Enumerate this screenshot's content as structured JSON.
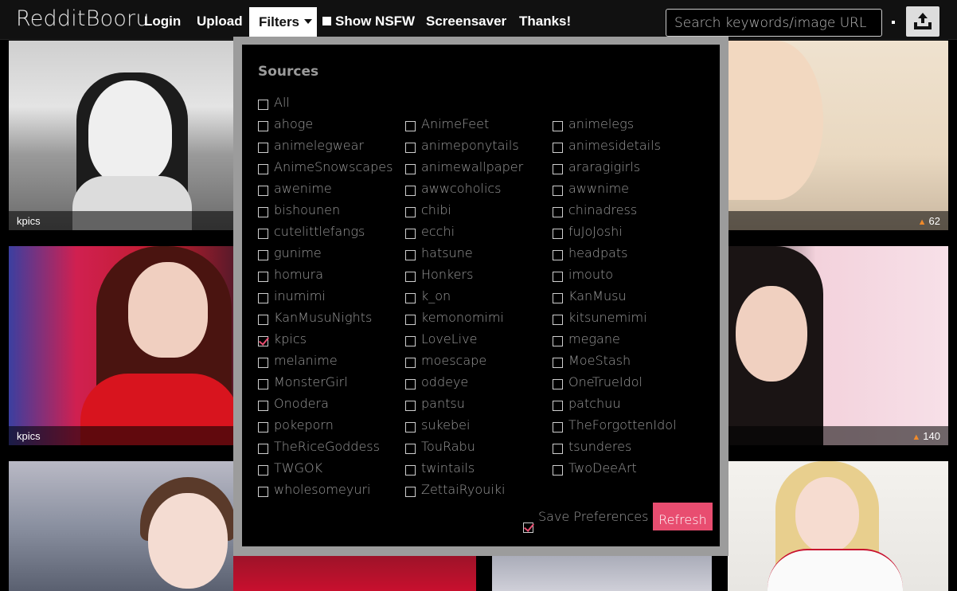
{
  "brand": "RedditBooru",
  "nav": {
    "login": "Login",
    "upload": "Upload",
    "filters": "Filters",
    "nsfw": "Show NSFW",
    "screensaver": "Screensaver",
    "thanks": "Thanks!"
  },
  "search": {
    "placeholder": "Search keywords/image URL",
    "value": ""
  },
  "upload_icon": "upload-tray-icon",
  "tiles": [
    {
      "caption": "kpics",
      "score": ""
    },
    {
      "caption": "kpics",
      "score": ""
    },
    {
      "caption": "",
      "score": "62"
    },
    {
      "caption": "",
      "score": "140"
    }
  ],
  "filters": {
    "title": "Sources",
    "all_label": "All",
    "sources": [
      {
        "label": "ahoge",
        "checked": false
      },
      {
        "label": "AnimeFeet",
        "checked": false
      },
      {
        "label": "animelegs",
        "checked": false
      },
      {
        "label": "animelegwear",
        "checked": false
      },
      {
        "label": "animeponytails",
        "checked": false
      },
      {
        "label": "animesidetails",
        "checked": false
      },
      {
        "label": "AnimeSnowscapes",
        "checked": false
      },
      {
        "label": "animewallpaper",
        "checked": false
      },
      {
        "label": "araragigirls",
        "checked": false
      },
      {
        "label": "awenime",
        "checked": false
      },
      {
        "label": "awwcoholics",
        "checked": false
      },
      {
        "label": "awwnime",
        "checked": false
      },
      {
        "label": "bishounen",
        "checked": false
      },
      {
        "label": "chibi",
        "checked": false
      },
      {
        "label": "chinadress",
        "checked": false
      },
      {
        "label": "cutelittlefangs",
        "checked": false
      },
      {
        "label": "ecchi",
        "checked": false
      },
      {
        "label": "fuJoJoshi",
        "checked": false
      },
      {
        "label": "gunime",
        "checked": false
      },
      {
        "label": "hatsune",
        "checked": false
      },
      {
        "label": "headpats",
        "checked": false
      },
      {
        "label": "homura",
        "checked": false
      },
      {
        "label": "Honkers",
        "checked": false
      },
      {
        "label": "imouto",
        "checked": false
      },
      {
        "label": "inumimi",
        "checked": false
      },
      {
        "label": "k_on",
        "checked": false
      },
      {
        "label": "KanMusu",
        "checked": false
      },
      {
        "label": "KanMusuNights",
        "checked": false
      },
      {
        "label": "kemonomimi",
        "checked": false
      },
      {
        "label": "kitsunemimi",
        "checked": false
      },
      {
        "label": "kpics",
        "checked": true
      },
      {
        "label": "LoveLive",
        "checked": false
      },
      {
        "label": "megane",
        "checked": false
      },
      {
        "label": "melanime",
        "checked": false
      },
      {
        "label": "moescape",
        "checked": false
      },
      {
        "label": "MoeStash",
        "checked": false
      },
      {
        "label": "MonsterGirl",
        "checked": false
      },
      {
        "label": "oddeye",
        "checked": false
      },
      {
        "label": "OneTrueIdol",
        "checked": false
      },
      {
        "label": "Onodera",
        "checked": false
      },
      {
        "label": "pantsu",
        "checked": false
      },
      {
        "label": "patchuu",
        "checked": false
      },
      {
        "label": "pokeporn",
        "checked": false
      },
      {
        "label": "sukebei",
        "checked": false
      },
      {
        "label": "TheForgottenIdol",
        "checked": false
      },
      {
        "label": "TheRiceGoddess",
        "checked": false
      },
      {
        "label": "TouRabu",
        "checked": false
      },
      {
        "label": "tsunderes",
        "checked": false
      },
      {
        "label": "TWGOK",
        "checked": false
      },
      {
        "label": "twintails",
        "checked": false
      },
      {
        "label": "TwoDeeArt",
        "checked": false
      },
      {
        "label": "wholesomeyuri",
        "checked": false
      },
      {
        "label": "ZettaiRyouiki",
        "checked": false
      }
    ],
    "save_label": "Save Preferences",
    "save_checked": true,
    "refresh_label": "Refresh"
  },
  "colors": {
    "accent": "#e84d70",
    "vote_arrow": "#f08a2a"
  }
}
